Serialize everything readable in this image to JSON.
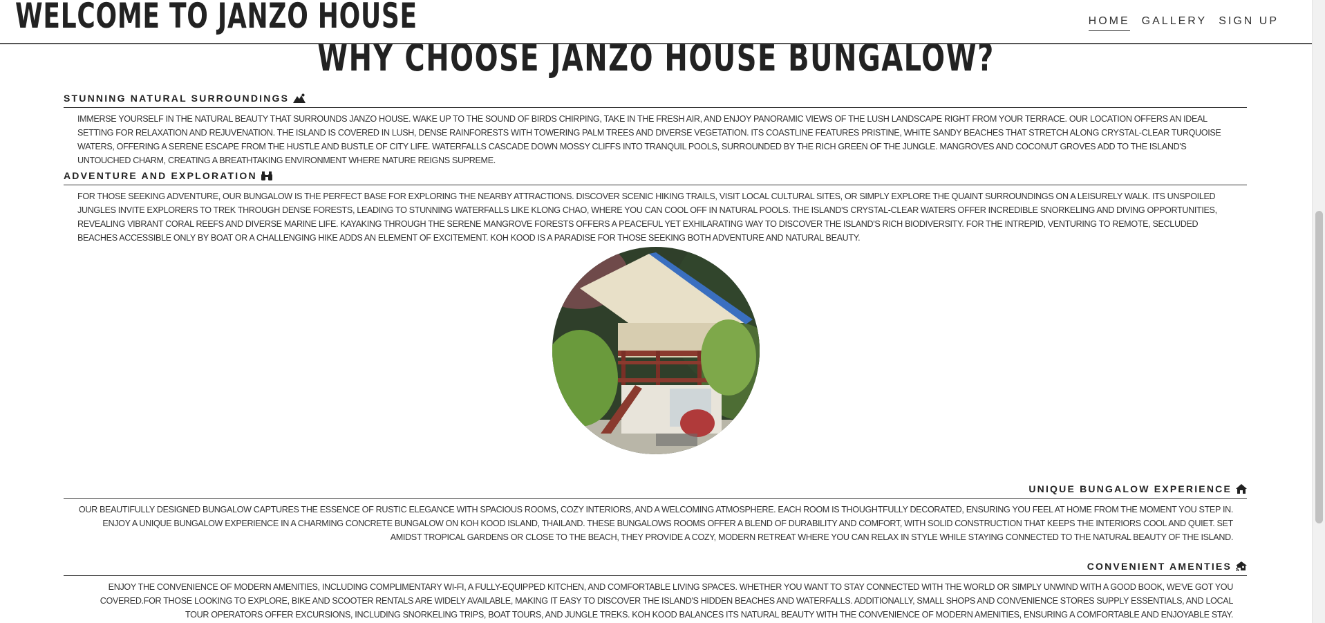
{
  "header": {
    "brand": "WELCOME TO JANZO HOUSE",
    "nav": [
      "HOME",
      "GALLERY",
      "SIGN UP"
    ]
  },
  "main": {
    "title": "WHY CHOOSE JANZO HOUSE BUNGALOW?",
    "sections": [
      {
        "heading": "STUNNING NATURAL SURROUNDINGS",
        "icon": "mountain-icon",
        "body": "IMMERSE YOURSELF IN THE NATURAL BEAUTY THAT SURROUNDS JANZO HOUSE. WAKE UP TO THE SOUND OF BIRDS CHIRPING, TAKE IN THE FRESH AIR, AND ENJOY PANORAMIC VIEWS OF THE LUSH LANDSCAPE RIGHT FROM YOUR TERRACE. OUR LOCATION OFFERS AN IDEAL SETTING FOR RELAXATION AND REJUVENATION. THE ISLAND IS COVERED IN LUSH, DENSE RAINFORESTS WITH TOWERING PALM TREES AND DIVERSE VEGETATION. ITS COASTLINE FEATURES PRISTINE, WHITE SANDY BEACHES THAT STRETCH ALONG CRYSTAL-CLEAR TURQUOISE WATERS, OFFERING A SERENE ESCAPE FROM THE HUSTLE AND BUSTLE OF CITY LIFE. WATERFALLS CASCADE DOWN MOSSY CLIFFS INTO TRANQUIL POOLS, SURROUNDED BY THE RICH GREEN OF THE JUNGLE. MANGROVES AND COCONUT GROVES ADD TO THE ISLAND'S UNTOUCHED CHARM, CREATING A BREATHTAKING ENVIRONMENT WHERE NATURE REIGNS SUPREME."
      },
      {
        "heading": "ADVENTURE AND EXPLORATION",
        "icon": "binoculars-icon",
        "body": "FOR THOSE SEEKING ADVENTURE, OUR BUNGALOW IS THE PERFECT BASE FOR EXPLORING THE NEARBY ATTRACTIONS. DISCOVER SCENIC HIKING TRAILS, VISIT LOCAL CULTURAL SITES, OR SIMPLY EXPLORE THE QUAINT SURROUNDINGS ON A LEISURELY WALK. ITS UNSPOILED JUNGLES INVITE EXPLORERS TO TREK THROUGH DENSE FORESTS, LEADING TO STUNNING WATERFALLS LIKE KLONG CHAO, WHERE YOU CAN COOL OFF IN NATURAL POOLS. THE ISLAND'S CRYSTAL-CLEAR WATERS OFFER INCREDIBLE SNORKELING AND DIVING OPPORTUNITIES, REVEALING VIBRANT CORAL REEFS AND DIVERSE MARINE LIFE. KAYAKING THROUGH THE SERENE MANGROVE FORESTS OFFERS A PEACEFUL YET EXHILARATING WAY TO DISCOVER THE ISLAND'S RICH BIODIVERSITY. FOR THE INTREPID, VENTURING TO REMOTE, SECLUDED BEACHES ACCESSIBLE ONLY BY BOAT OR A CHALLENGING HIKE ADDS AN ELEMENT OF EXCITEMENT. KOH KOOD IS A PARADISE FOR THOSE SEEKING BOTH ADVENTURE AND NATURAL BEAUTY."
      },
      {
        "heading": "UNIQUE BUNGALOW EXPERIENCE",
        "icon": "house-icon",
        "body": "OUR BEAUTIFULLY DESIGNED BUNGALOW CAPTURES THE ESSENCE OF RUSTIC ELEGANCE WITH SPACIOUS ROOMS, COZY INTERIORS, AND A WELCOMING ATMOSPHERE. EACH ROOM IS THOUGHTFULLY DECORATED, ENSURING YOU FEEL AT HOME FROM THE MOMENT YOU STEP IN. ENJOY A UNIQUE BUNGALOW EXPERIENCE IN A CHARMING CONCRETE BUNGALOW ON KOH KOOD ISLAND, THAILAND. THESE BUNGALOWS ROOMS OFFER A BLEND OF DURABILITY AND COMFORT, WITH SOLID CONSTRUCTION THAT KEEPS THE INTERIORS COOL AND QUIET. SET AMIDST TROPICAL GARDENS OR CLOSE TO THE BEACH, THEY PROVIDE A COZY, MODERN RETREAT WHERE YOU CAN RELAX IN STYLE WHILE STAYING CONNECTED TO THE NATURAL BEAUTY OF THE ISLAND."
      },
      {
        "heading": "CONVENIENT AMENTIES",
        "icon": "house-signal-icon",
        "body": "ENJOY THE CONVENIENCE OF MODERN AMENITIES, INCLUDING COMPLIMENTARY WI-FI, A FULLY-EQUIPPED KITCHEN, AND COMFORTABLE LIVING SPACES. WHETHER YOU WANT TO STAY CONNECTED WITH THE WORLD OR SIMPLY UNWIND WITH A GOOD BOOK, WE'VE GOT YOU COVERED.FOR THOSE LOOKING TO EXPLORE, BIKE AND SCOOTER RENTALS ARE WIDELY AVAILABLE, MAKING IT EASY TO DISCOVER THE ISLAND'S HIDDEN BEACHES AND WATERFALLS. ADDITIONALLY, SMALL SHOPS AND CONVENIENCE STORES SUPPLY ESSENTIALS, AND LOCAL TOUR OPERATORS OFFER EXCURSIONS, INCLUDING SNORKELING TRIPS, BOAT TOURS, AND JUNGLE TREKS. KOH KOOD BALANCES ITS NATURAL BEAUTY WITH THE CONVENIENCE OF MODERN AMENITIES, ENSURING A COMFORTABLE AND ENJOYABLE STAY."
      }
    ]
  }
}
